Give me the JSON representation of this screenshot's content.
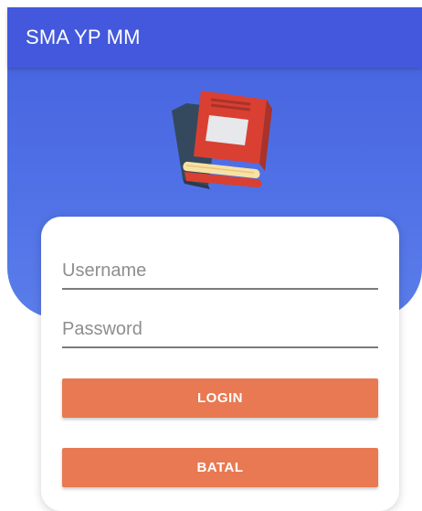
{
  "appbar": {
    "title": "SMA YP MM"
  },
  "logo": {
    "icon": "books-icon"
  },
  "login_form": {
    "username": {
      "placeholder": "Username",
      "value": ""
    },
    "password": {
      "placeholder": "Password",
      "value": ""
    },
    "login_label": "LOGIN",
    "cancel_label": "BATAL"
  },
  "colors": {
    "appbar": "#4358dc",
    "background_blue": "#4f70e6",
    "button": "#e87952",
    "card": "#ffffff"
  }
}
